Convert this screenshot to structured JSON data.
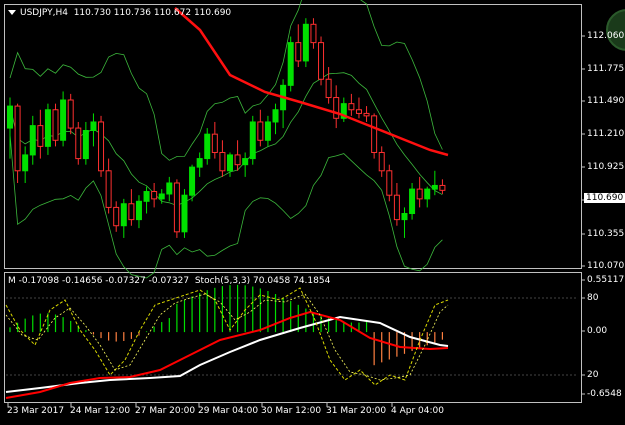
{
  "main": {
    "symbol": "USDJPY,H4",
    "ohlc": "110.730 110.736 110.672 110.690",
    "current_price": "110.690",
    "price_ticks": [
      "112.060",
      "111.775",
      "111.490",
      "111.210",
      "110.925",
      "110.640",
      "110.355",
      "110.070"
    ],
    "price_range": [
      110.07,
      112.2
    ]
  },
  "sub": {
    "label_prefix": "M",
    "macd_values": "-0.17098 -0.14656 -0.07327 -0.07327",
    "stoch_label": "Stoch(5,3,3)",
    "stoch_values": "70.0458 74.1854",
    "ticks": [
      "0.55117",
      "80",
      "0.00",
      "20",
      "-0.6548"
    ],
    "range": [
      -0.6548,
      0.55117
    ]
  },
  "time_axis": [
    "23 Mar 2017",
    "24 Mar 12:00",
    "27 Mar 20:00",
    "29 Mar 04:00",
    "30 Mar 12:00",
    "31 Mar 20:00",
    "4 Apr 04:00"
  ],
  "colors": {
    "bull": "#00e000",
    "bear": "#ff3030",
    "ma": "#ff1010",
    "bands": "#3cb83c",
    "macd_signal_white": "#ffffff",
    "macd_red": "#ff0000",
    "stoch_dash": "#d8d800",
    "grid": "#c0c0c0"
  },
  "chart_data": {
    "type": "candlestick",
    "title": "USDJPY,H4",
    "ylim": [
      110.07,
      112.2
    ],
    "candles": [
      [
        111.2,
        111.45,
        110.95,
        111.38
      ],
      [
        111.38,
        111.4,
        110.75,
        110.85
      ],
      [
        110.85,
        111.05,
        110.75,
        110.98
      ],
      [
        110.98,
        111.3,
        110.9,
        111.22
      ],
      [
        111.22,
        111.35,
        110.95,
        111.05
      ],
      [
        111.05,
        111.4,
        110.98,
        111.35
      ],
      [
        111.35,
        111.4,
        111.05,
        111.1
      ],
      [
        111.1,
        111.5,
        111.05,
        111.43
      ],
      [
        111.43,
        111.48,
        111.15,
        111.2
      ],
      [
        111.2,
        111.25,
        110.9,
        110.95
      ],
      [
        110.95,
        111.25,
        110.9,
        111.18
      ],
      [
        111.18,
        111.32,
        111.05,
        111.25
      ],
      [
        111.25,
        111.3,
        110.8,
        110.85
      ],
      [
        110.85,
        110.95,
        110.5,
        110.55
      ],
      [
        110.55,
        110.6,
        110.35,
        110.4
      ],
      [
        110.4,
        110.62,
        110.3,
        110.58
      ],
      [
        110.58,
        110.7,
        110.4,
        110.45
      ],
      [
        110.45,
        110.65,
        110.38,
        110.6
      ],
      [
        110.6,
        110.72,
        110.5,
        110.68
      ],
      [
        110.68,
        110.75,
        110.55,
        110.62
      ],
      [
        110.62,
        110.7,
        110.58,
        110.66
      ],
      [
        110.66,
        110.8,
        110.6,
        110.75
      ],
      [
        110.75,
        110.78,
        110.3,
        110.35
      ],
      [
        110.35,
        110.7,
        110.3,
        110.65
      ],
      [
        110.65,
        110.9,
        110.6,
        110.88
      ],
      [
        110.88,
        111.0,
        110.8,
        110.95
      ],
      [
        110.95,
        111.2,
        110.9,
        111.15
      ],
      [
        111.15,
        111.25,
        110.95,
        111.0
      ],
      [
        111.0,
        111.1,
        110.8,
        110.85
      ],
      [
        110.85,
        111.0,
        110.8,
        110.98
      ],
      [
        110.98,
        111.1,
        110.85,
        110.9
      ],
      [
        110.9,
        111.0,
        110.8,
        110.95
      ],
      [
        110.95,
        111.3,
        110.9,
        111.25
      ],
      [
        111.25,
        111.35,
        111.05,
        111.1
      ],
      [
        111.1,
        111.3,
        111.05,
        111.25
      ],
      [
        111.25,
        111.4,
        111.15,
        111.35
      ],
      [
        111.35,
        111.6,
        111.2,
        111.55
      ],
      [
        111.55,
        111.95,
        111.5,
        111.9
      ],
      [
        111.9,
        112.05,
        111.7,
        111.75
      ],
      [
        111.75,
        112.1,
        111.7,
        112.05
      ],
      [
        112.05,
        112.1,
        111.85,
        111.9
      ],
      [
        111.9,
        111.95,
        111.55,
        111.6
      ],
      [
        111.6,
        111.7,
        111.4,
        111.45
      ],
      [
        111.45,
        111.55,
        111.2,
        111.28
      ],
      [
        111.28,
        111.45,
        111.25,
        111.4
      ],
      [
        111.4,
        111.48,
        111.3,
        111.35
      ],
      [
        111.35,
        111.45,
        111.28,
        111.32
      ],
      [
        111.32,
        111.38,
        111.25,
        111.3
      ],
      [
        111.3,
        111.32,
        110.95,
        111.0
      ],
      [
        111.0,
        111.05,
        110.8,
        110.85
      ],
      [
        110.85,
        110.9,
        110.6,
        110.65
      ],
      [
        110.65,
        110.75,
        110.4,
        110.45
      ],
      [
        110.45,
        110.55,
        110.3,
        110.5
      ],
      [
        110.5,
        110.75,
        110.45,
        110.7
      ],
      [
        110.7,
        110.8,
        110.55,
        110.62
      ],
      [
        110.62,
        110.72,
        110.55,
        110.7
      ],
      [
        110.7,
        110.85,
        110.65,
        110.73
      ],
      [
        110.73,
        110.78,
        110.66,
        110.69
      ]
    ]
  }
}
